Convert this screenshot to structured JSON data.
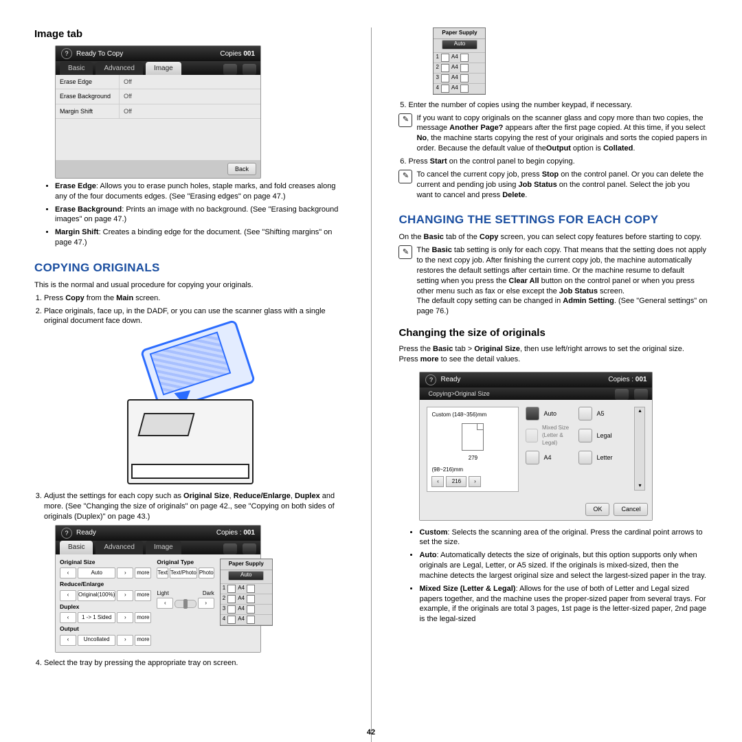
{
  "page_number": "42",
  "left": {
    "h_image_tab": "Image tab",
    "panel1": {
      "status": "Ready To Copy",
      "copies_label": "Copies",
      "copies_value": "001",
      "tabs": [
        "Basic",
        "Advanced",
        "Image"
      ],
      "rows": [
        {
          "k": "Erase Edge",
          "v": "Off"
        },
        {
          "k": "Erase Background",
          "v": "Off"
        },
        {
          "k": "Margin Shift",
          "v": "Off"
        }
      ],
      "back": "Back"
    },
    "bul1_a": "Erase Edge",
    "bul1_b": ": Allows you to erase punch holes, staple marks, and fold creases along any of the four documents edges. (See \"Erasing edges\" on page 47.)",
    "bul2_a": "Erase Background",
    "bul2_b": ": Prints an image with no background. (See \"Erasing background images\" on page 47.)",
    "bul3_a": "Margin Shift",
    "bul3_b": ": Creates a binding edge for the document. (See \"Shifting margins\" on page 47.)",
    "h_copying": "COPYING ORIGINALS",
    "copy_intro": "This is the normal and usual procedure for copying your originals.",
    "step1_a": "Press ",
    "step1_b": "Copy",
    "step1_c": " from the ",
    "step1_d": "Main",
    "step1_e": " screen.",
    "step2": "Place originals, face up, in the DADF, or you can use the scanner glass with a single original document face down.",
    "step3_a": "Adjust the settings for each copy such as ",
    "step3_b": "Original Size",
    "step3_c": ", ",
    "step3_d": "Reduce/Enlarge",
    "step3_e": ", ",
    "step3_f": "Duplex",
    "step3_g": " and more. (See \"Changing the size of originals\" on page 42., see \"Copying on both sides of originals (Duplex)\" on page 43.)",
    "panel2": {
      "status": "Ready",
      "copies_label": "Copies :",
      "copies_value": "001",
      "tabs": [
        "Basic",
        "Advanced",
        "Image"
      ],
      "col_os": "Original Size",
      "os_val": "Auto",
      "more": "more",
      "col_re": "Reduce/Enlarge",
      "re_val": "Original(100%)",
      "col_dup": "Duplex",
      "dup_val": "1 -> 1 Sided",
      "col_out": "Output",
      "out_val": "Uncollated",
      "col_ot": "Original Type",
      "ot_a": "Text",
      "ot_b": "Text/Photo",
      "ot_c": "Photo",
      "light": "Light",
      "dark": "Dark",
      "col_ps": "Paper Supply",
      "ps_auto": "Auto",
      "trays": [
        "1",
        "2",
        "3",
        "4"
      ],
      "tray_size": "A4"
    },
    "step4": "Select the tray by pressing the appropriate tray on screen."
  },
  "right": {
    "psup": {
      "title": "Paper Supply",
      "auto": "Auto",
      "rows": [
        "1",
        "2",
        "3",
        "4"
      ],
      "size": "A4"
    },
    "step5": "Enter the number of copies using the number keypad, if necessary.",
    "note1_a": "If you want to copy originals on the scanner glass and copy more than two copies, the message ",
    "note1_b": "Another Page?",
    "note1_c": " appears after the first page copied. At this time, if you select ",
    "note1_d": "No",
    "note1_e": ", the machine starts copying the rest of your originals and sorts the copied papers in order. Because the default value of the",
    "note1_f": "Output",
    "note1_g": " option is ",
    "note1_h": "Collated",
    "note1_i": ".",
    "step6_a": "Press ",
    "step6_b": "Start",
    "step6_c": " on the control panel to begin copying.",
    "note2_a": "To cancel the current copy job, press ",
    "note2_b": "Stop",
    "note2_c": " on the control panel. Or you can delete the current and pending job using ",
    "note2_d": "Job Status",
    "note2_e": " on the control panel. Select the job you want to cancel and press ",
    "note2_f": "Delete",
    "note2_g": ".",
    "h_changing": "CHANGING THE SETTINGS FOR EACH COPY",
    "intro_a": "On the ",
    "intro_b": "Basic",
    "intro_c": " tab of the ",
    "intro_d": "Copy",
    "intro_e": " screen, you can select copy features before starting to copy.",
    "note3_a": "The ",
    "note3_b": "Basic",
    "note3_c": " tab setting is only for each copy. That means that the setting does not apply to the next copy job. After finishing the current copy job, the machine automatically restores the default settings after certain time. Or the machine resume to default setting when you press the ",
    "note3_d": "Clear All",
    "note3_e": " button on the control panel or when you press other menu such as fax or else except the ",
    "note3_f": "Job Status",
    "note3_g": " screen.",
    "note3_h": "The default copy setting can be changed in ",
    "note3_i": "Admin Setting",
    "note3_j": ". (See \"General settings\" on page 76.)",
    "h_size": "Changing the size of originals",
    "size_a": "Press the ",
    "size_b": "Basic",
    "size_c": " tab > ",
    "size_d": "Original Size",
    "size_e": ", then use left/right arrows to set the original size.",
    "size2_a": "Press ",
    "size2_b": "more",
    "size2_c": " to see the detail values.",
    "panel3": {
      "status": "Ready",
      "copies_label": "Copies :",
      "copies_value": "001",
      "bread": "Copying>Original Size",
      "custom": "Custom (148~356)mm",
      "custom_v": "279",
      "range": "(98~216)mm",
      "range_v": "216",
      "opts": {
        "auto": "Auto",
        "a5": "A5",
        "mixed": "Mixed Size\n(Letter & Legal)",
        "legal": "Legal",
        "a4": "A4",
        "letter": "Letter"
      },
      "ok": "OK",
      "cancel": "Cancel"
    },
    "b1_a": "Custom",
    "b1_b": ": Selects the scanning area of the original. Press the cardinal point arrows to set the size.",
    "b2_a": "Auto",
    "b2_b": ": Automatically detects the size of originals, but this option supports only when originals are Legal, Letter, or A5 sized. If the originals is mixed-sized, then the machine detects the largest original size and select the largest-sized paper in the tray.",
    "b3_a": "Mixed Size (Letter & Legal)",
    "b3_b": ": Allows for the use of both of Letter and Legal sized papers together, and the machine uses the proper-sized paper from several trays. For example, if the originals are total 3 pages, 1st page is the letter-sized paper, 2nd page is the legal-sized"
  }
}
